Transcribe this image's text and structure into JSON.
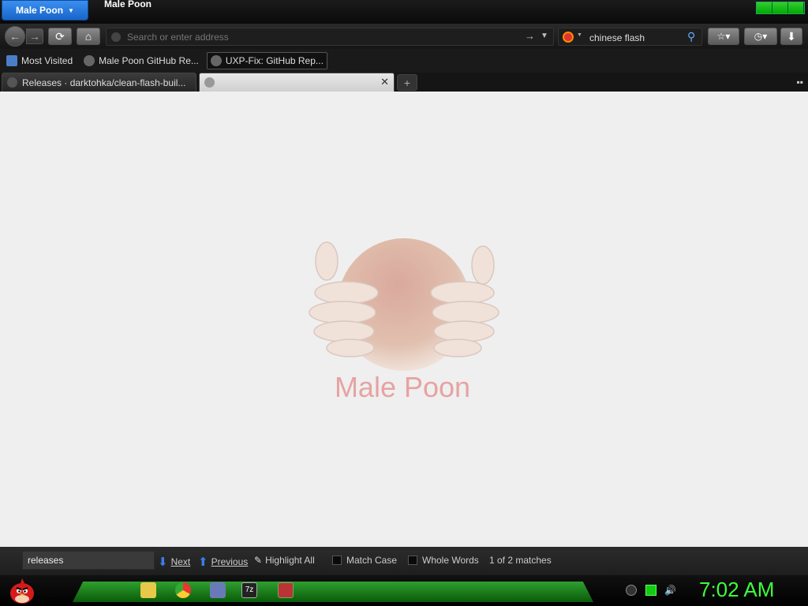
{
  "window": {
    "app_menu_label": "Male Poon",
    "title": "Male Poon"
  },
  "navbar": {
    "address_placeholder": "Search or enter address",
    "search_value": "chinese flash"
  },
  "bookmarks": [
    {
      "label": "Most Visited"
    },
    {
      "label": "Male Poon GitHub Re..."
    },
    {
      "label": "UXP-Fix: GitHub Rep..."
    }
  ],
  "tabs": [
    {
      "label": "Releases · darktohka/clean-flash-buil..."
    },
    {
      "label": ""
    }
  ],
  "content": {
    "brand_text": "Male Poon"
  },
  "findbar": {
    "query": "releases",
    "next_label": "Next",
    "previous_label": "Previous",
    "highlight_label": "Highlight All",
    "match_case_label": "Match Case",
    "whole_words_label": "Whole Words",
    "status": "1 of 2 matches"
  },
  "taskbar": {
    "clock": "7:02 AM",
    "accent": "#2ea02e"
  }
}
